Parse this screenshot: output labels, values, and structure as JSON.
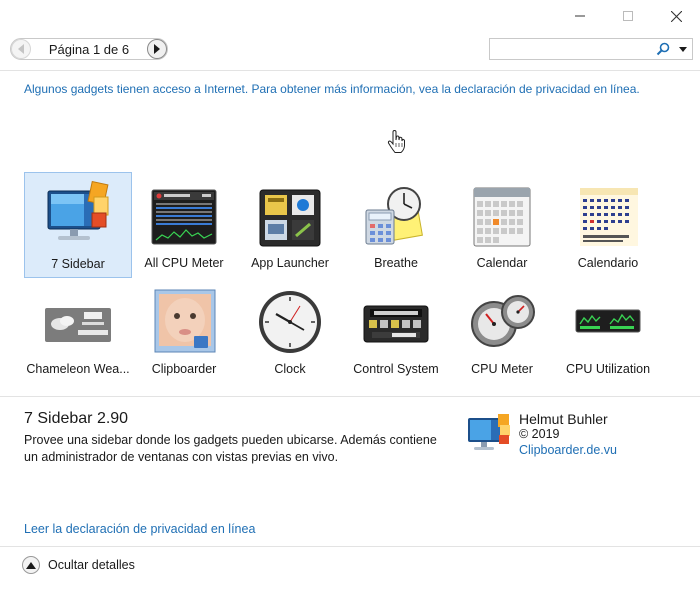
{
  "window": {
    "controls": {
      "minimize_icon": "minimize-icon",
      "maximize_icon": "maximize-icon",
      "close_icon": "close-icon"
    }
  },
  "toolbar": {
    "page_indicator": "Página 1 de 6",
    "search": {
      "value": "",
      "placeholder": ""
    }
  },
  "privacy_notice": "Algunos gadgets tienen acceso a Internet. Para obtener más información, vea la declaración de privacidad en línea.",
  "gadgets": [
    {
      "label": "7 Sidebar",
      "icon": "monitor-sidebar-icon",
      "selected": true
    },
    {
      "label": "All CPU Meter",
      "icon": "cpu-meter-screen-icon",
      "selected": false
    },
    {
      "label": "App Launcher",
      "icon": "app-launcher-icon",
      "selected": false
    },
    {
      "label": "Breathe",
      "icon": "breathe-clock-calculator-icon",
      "selected": false
    },
    {
      "label": "Calendar",
      "icon": "calendar-grid-icon",
      "selected": false
    },
    {
      "label": "Calendario",
      "icon": "calendario-icon",
      "selected": false
    },
    {
      "label": "Chameleon Wea...",
      "icon": "weather-icon",
      "selected": false
    },
    {
      "label": "Clipboarder",
      "icon": "clipboarder-photo-icon",
      "selected": false
    },
    {
      "label": "Clock",
      "icon": "clock-icon",
      "selected": false
    },
    {
      "label": "Control System",
      "icon": "control-system-icon",
      "selected": false
    },
    {
      "label": "CPU Meter",
      "icon": "cpu-gauge-icon",
      "selected": false
    },
    {
      "label": "CPU Utilization",
      "icon": "cpu-utilization-icon",
      "selected": false
    }
  ],
  "details": {
    "title": "7 Sidebar 2.90",
    "description": "Provee una sidebar donde los gadgets pueden ubicarse. Además contiene un administrador de ventanas con vistas previas en vivo.",
    "author": "Helmut Buhler",
    "copyright": "© 2019",
    "website": "Clipboarder.de.vu",
    "privacy_link": "Leer la declaración de privacidad en línea",
    "toggle_label": "Ocultar detalles"
  },
  "colors": {
    "link": "#1f6fb4",
    "selection_bg": "#dcebfa",
    "selection_border": "#9cc3ec"
  }
}
